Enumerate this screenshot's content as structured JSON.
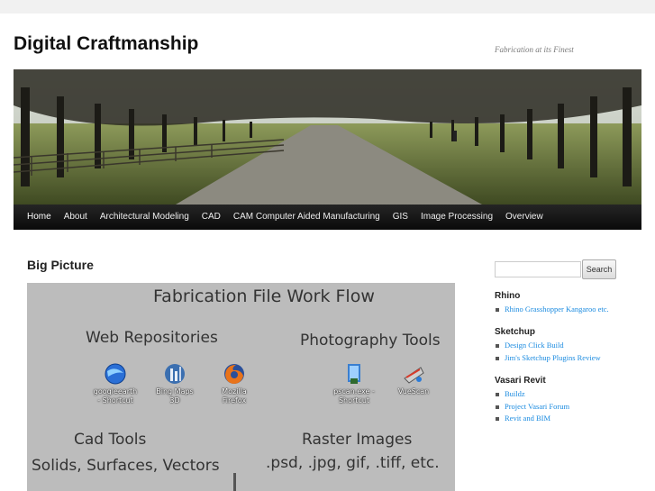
{
  "site": {
    "title": "Digital Craftmanship",
    "description": "Fabrication at its Finest"
  },
  "nav": {
    "items": [
      {
        "label": "Home",
        "current": true
      },
      {
        "label": "About"
      },
      {
        "label": "Architectural Modeling"
      },
      {
        "label": "CAD"
      },
      {
        "label": "CAM Computer Aided Manufacturing"
      },
      {
        "label": "GIS"
      },
      {
        "label": "Image Processing"
      },
      {
        "label": "Overview"
      }
    ]
  },
  "post": {
    "title": "Big Picture",
    "image": {
      "heading": "Fabrication File Work Flow",
      "web_repositories": "Web Repositories",
      "photography_tools": "Photography Tools",
      "cad_tools": "Cad Tools",
      "cad_sub": "Solids, Surfaces, Vectors",
      "raster_images": "Raster Images",
      "raster_sub": ".psd,  .jpg,  gif,  .tiff, etc.",
      "apps": [
        {
          "line1": "googleearth",
          "line2": "- Shortcut",
          "icon": "google-earth-icon"
        },
        {
          "line1": "Bing Maps",
          "line2": "3D",
          "icon": "bing-maps-icon"
        },
        {
          "line1": "Mozilla",
          "line2": "Firefox",
          "icon": "firefox-icon"
        },
        {
          "line1": "pscan.exe -",
          "line2": "Shortcut",
          "icon": "pscan-icon"
        },
        {
          "line1": "VueScan",
          "line2": "",
          "icon": "vuescan-icon"
        }
      ]
    }
  },
  "sidebar": {
    "search_placeholder": "",
    "search_button": "Search",
    "widgets": [
      {
        "title": "Rhino",
        "links": [
          "Rhino Grasshopper Kangaroo etc."
        ]
      },
      {
        "title": "Sketchup",
        "links": [
          "Design Click Build",
          "Jim's Sketchup Plugins Review"
        ]
      },
      {
        "title": "Vasari Revit",
        "links": [
          "Buildz",
          "Project Vasari Forum",
          "Revit and BIM"
        ]
      }
    ]
  },
  "colors": {
    "link": "#1b8be0",
    "nav_bg": "#0a0a0a",
    "workflow_bg": "#bcbcbc"
  }
}
